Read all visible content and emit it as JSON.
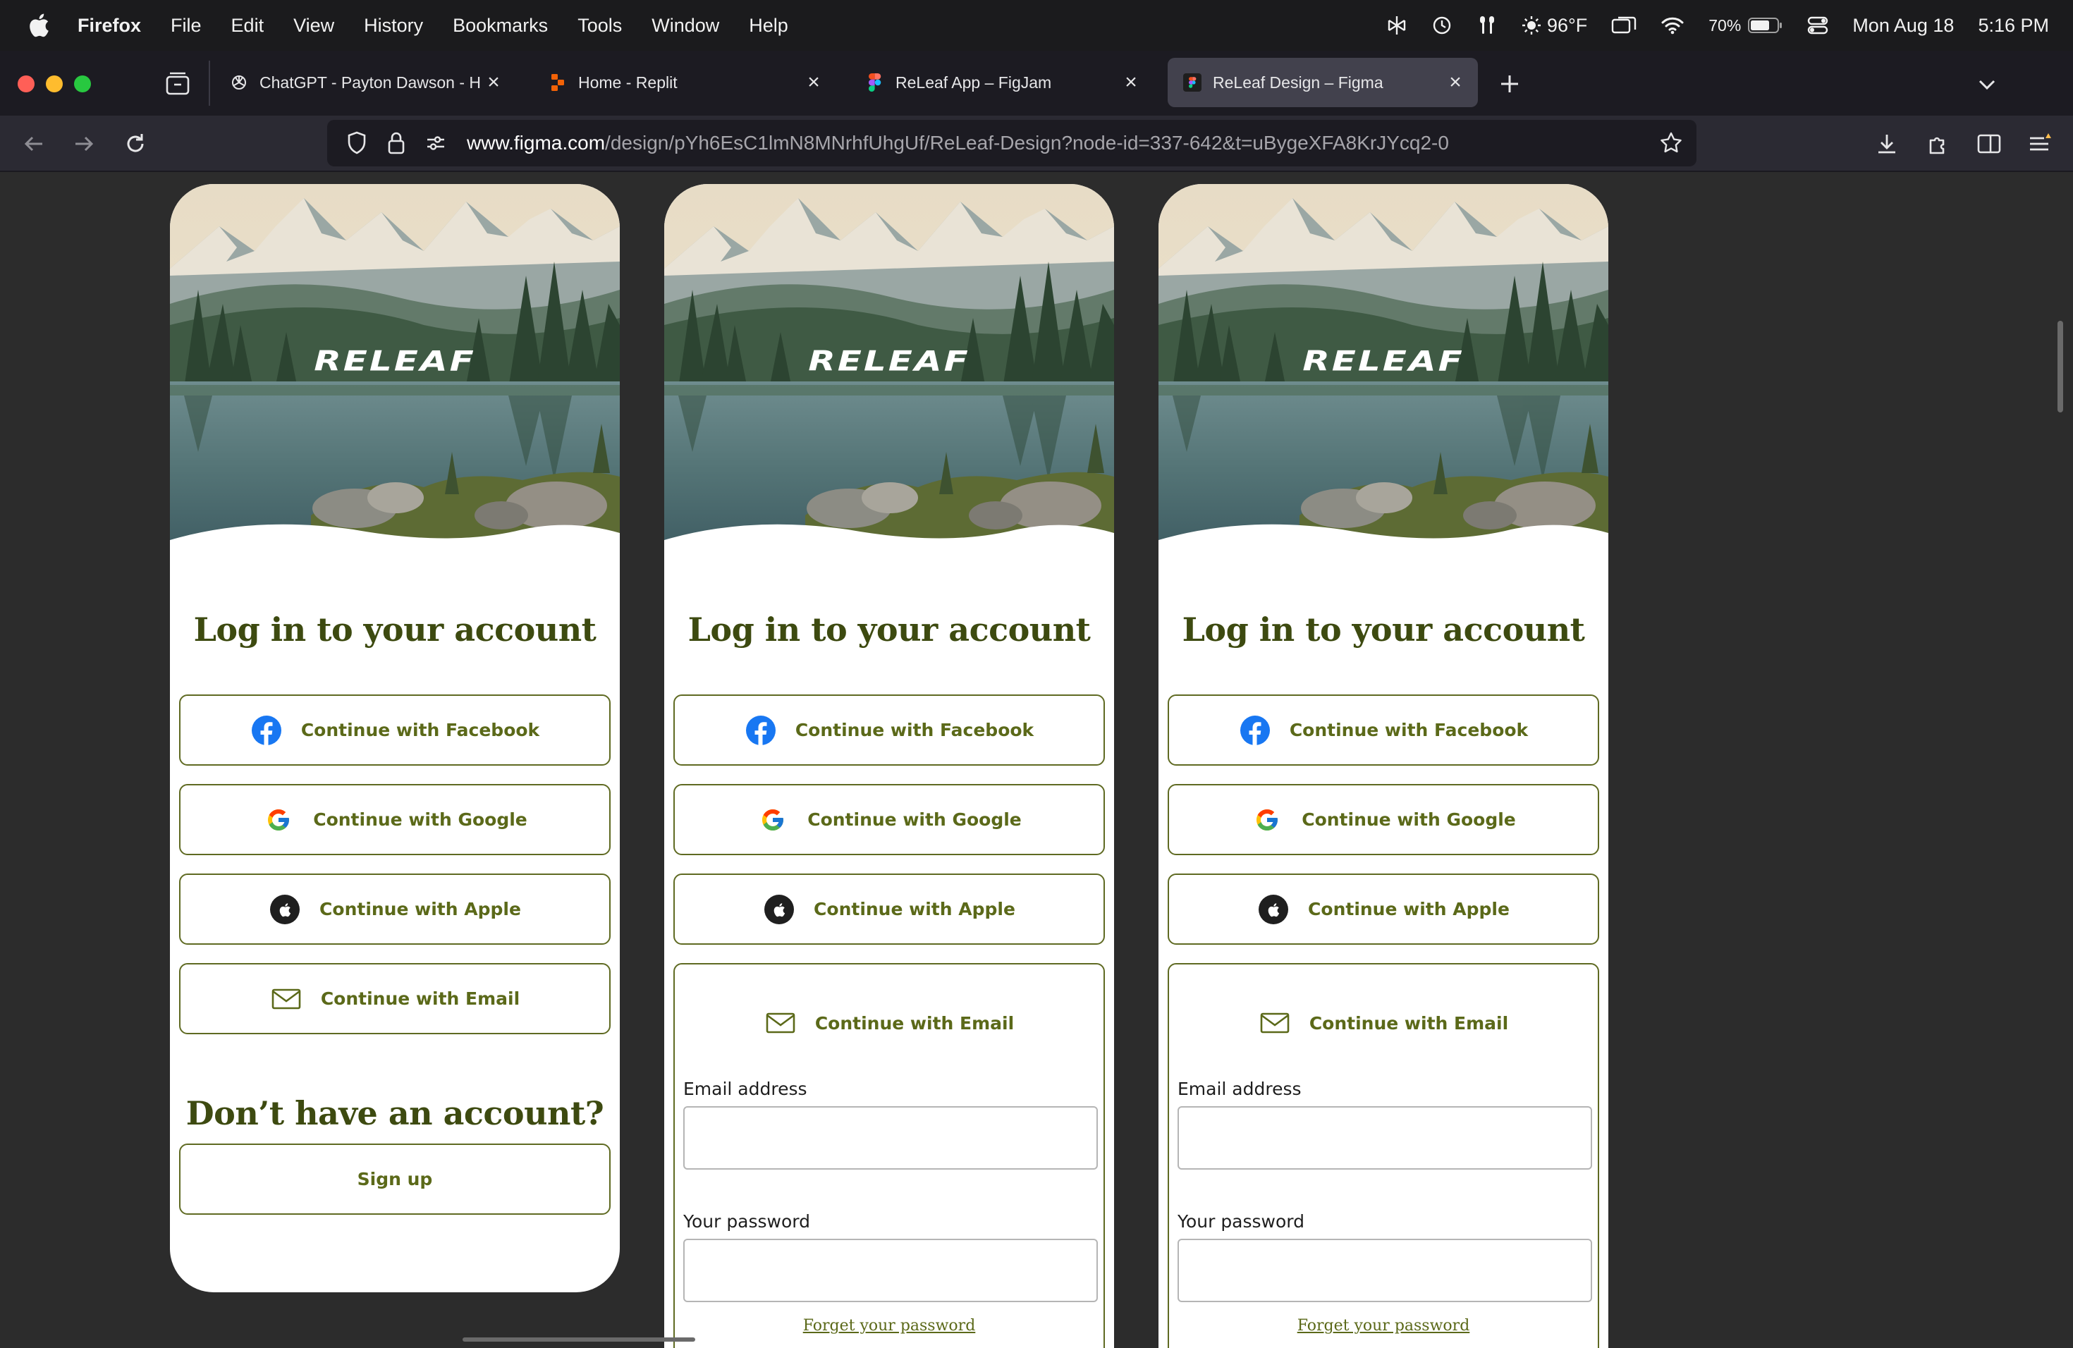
{
  "menubar": {
    "app_name": "Firefox",
    "items": [
      "File",
      "Edit",
      "View",
      "History",
      "Bookmarks",
      "Tools",
      "Window",
      "Help"
    ],
    "weather": "96°F",
    "battery": "70%",
    "date": "Mon Aug 18",
    "time": "5:16 PM"
  },
  "browser": {
    "tabs": [
      {
        "label": "ChatGPT - Payton Dawson - Hu",
        "icon": "openai-icon"
      },
      {
        "label": "Home - Replit",
        "icon": "replit-icon"
      },
      {
        "label": "ReLeaf App – FigJam",
        "icon": "figma-icon"
      },
      {
        "label": "ReLeaf Design – Figma",
        "icon": "figma-icon",
        "active": true
      }
    ],
    "url_host": "www.figma.com",
    "url_path": "/design/pYh6EsC1lmN8MNrhfUhgUf/ReLeaf-Design?node-id=337-642&t=uBygeXFA8KrJYcq2-0"
  },
  "colors": {
    "accent_olive": "#5b6919",
    "heading_olive": "#3d4a10",
    "facebook_blue": "#1877f2"
  },
  "screens": {
    "logo": "RELEAF",
    "login_title": "Log in to your account",
    "facebook_label": "Continue with Facebook",
    "google_label": "Continue with Google",
    "apple_label": "Continue with Apple",
    "email_label": "Continue with Email",
    "signup_title": "Don’t have an account?",
    "signup_label": "Sign up",
    "email_field_label": "Email address",
    "password_field_label": "Your password",
    "forgot_label": "Forget your password"
  }
}
